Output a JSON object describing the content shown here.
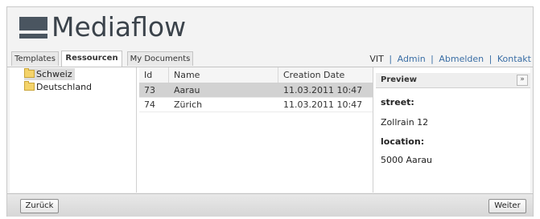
{
  "app": {
    "logo_text": "Mediaflow"
  },
  "tabs": [
    {
      "label": "Templates",
      "active": false
    },
    {
      "label": "Ressourcen",
      "active": true
    },
    {
      "label": "My Documents",
      "active": false
    }
  ],
  "top_links": {
    "user": "VIT",
    "admin": "Admin",
    "logout": "Abmelden",
    "contact": "Kontakt",
    "separator": "|"
  },
  "tree": {
    "items": [
      {
        "label": "Schweiz",
        "icon": "folder-icon",
        "selected": true
      },
      {
        "label": "Deutschland",
        "icon": "folder-icon",
        "selected": false
      }
    ]
  },
  "grid": {
    "columns": [
      "Id",
      "Name",
      "Creation Date"
    ],
    "rows": [
      {
        "id": "73",
        "name": "Aarau",
        "date": "11.03.2011 10:47",
        "selected": true
      },
      {
        "id": "74",
        "name": "Zürich",
        "date": "11.03.2011 10:47",
        "selected": false
      }
    ]
  },
  "preview": {
    "title": "Preview",
    "collapse_label": "»",
    "fields": [
      {
        "label": "street:",
        "value": "Zollrain 12"
      },
      {
        "label": "location:",
        "value": "5000 Aarau"
      }
    ]
  },
  "footer": {
    "back_label": "Zurück",
    "next_label": "Weiter"
  },
  "colors": {
    "link": "#3a6ea5",
    "logo": "#3b434b",
    "selection": "#d2d2d2"
  }
}
